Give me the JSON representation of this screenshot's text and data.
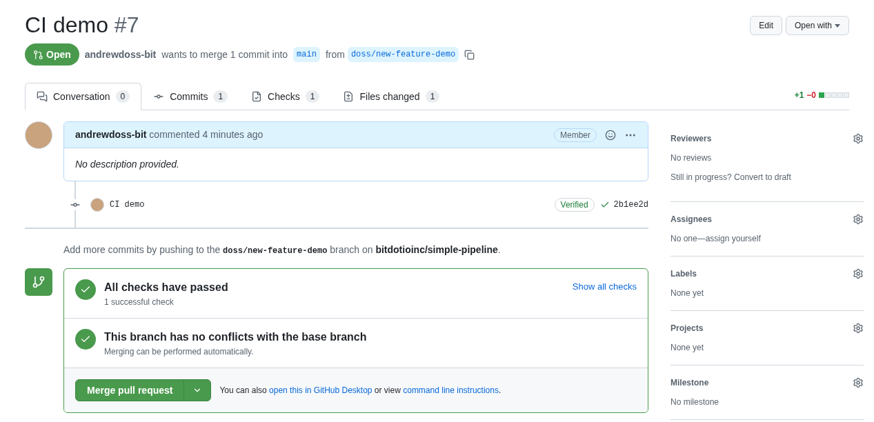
{
  "header": {
    "title": "CI demo",
    "number": "#7",
    "buttons": [
      {
        "label": "Edit",
        "kind": "plain"
      },
      {
        "label": "Open with",
        "kind": "dropdown"
      }
    ]
  },
  "status": {
    "state": "Open",
    "author": "andrewdoss-bit",
    "text_1": "wants to merge 1 commit into",
    "base": "main",
    "text_2": "from",
    "head": "doss/new-feature-demo"
  },
  "tabs": [
    {
      "label": "Conversation",
      "count": "0",
      "kind": "conversation",
      "selected": true
    },
    {
      "label": "Commits",
      "count": "1",
      "kind": "commit",
      "selected": false
    },
    {
      "label": "Checks",
      "count": "1",
      "kind": "checks",
      "selected": false
    },
    {
      "label": "Files changed",
      "count": "1",
      "kind": "files",
      "selected": false
    }
  ],
  "diffstat": {
    "added": "+1",
    "removed": "−0",
    "level": 0.2
  },
  "comment": {
    "author": "andrewdoss-bit",
    "action": "commented 4 minutes ago",
    "badge": "Member",
    "body": "No description provided."
  },
  "commit": {
    "message": "CI demo",
    "verified": "Verified",
    "sha": "2b1ee2d"
  },
  "push_note": [
    {
      "kind": "text",
      "text": "Add more commits by pushing to the "
    },
    {
      "kind": "code",
      "text": "doss/new-feature-demo"
    },
    {
      "kind": "text",
      "text": " branch on "
    },
    {
      "kind": "bold",
      "text": "bitdotioinc/simple-pipeline"
    },
    {
      "kind": "text",
      "text": "."
    }
  ],
  "merge_box": {
    "checks": [
      {
        "title": "All checks have passed",
        "subtitle": "1 successful check",
        "link": "Show all checks"
      },
      {
        "title": "This branch has no conflicts with the base branch",
        "subtitle": "Merging can be performed automatically."
      }
    ],
    "merge_button": "Merge pull request",
    "note": [
      {
        "kind": "text",
        "text": "You can also "
      },
      {
        "kind": "link",
        "text": "open this in GitHub Desktop"
      },
      {
        "kind": "text",
        "text": " or view "
      },
      {
        "kind": "link",
        "text": "command line instructions"
      },
      {
        "kind": "text",
        "text": "."
      }
    ]
  },
  "sidebar": [
    {
      "title": "Reviewers",
      "lines": [
        "No reviews",
        "Still in progress? Convert to draft"
      ]
    },
    {
      "title": "Assignees",
      "lines": [
        "No one—assign yourself"
      ]
    },
    {
      "title": "Labels",
      "lines": [
        "None yet"
      ]
    },
    {
      "title": "Projects",
      "lines": [
        "None yet"
      ]
    },
    {
      "title": "Milestone",
      "lines": [
        "No milestone"
      ]
    }
  ]
}
